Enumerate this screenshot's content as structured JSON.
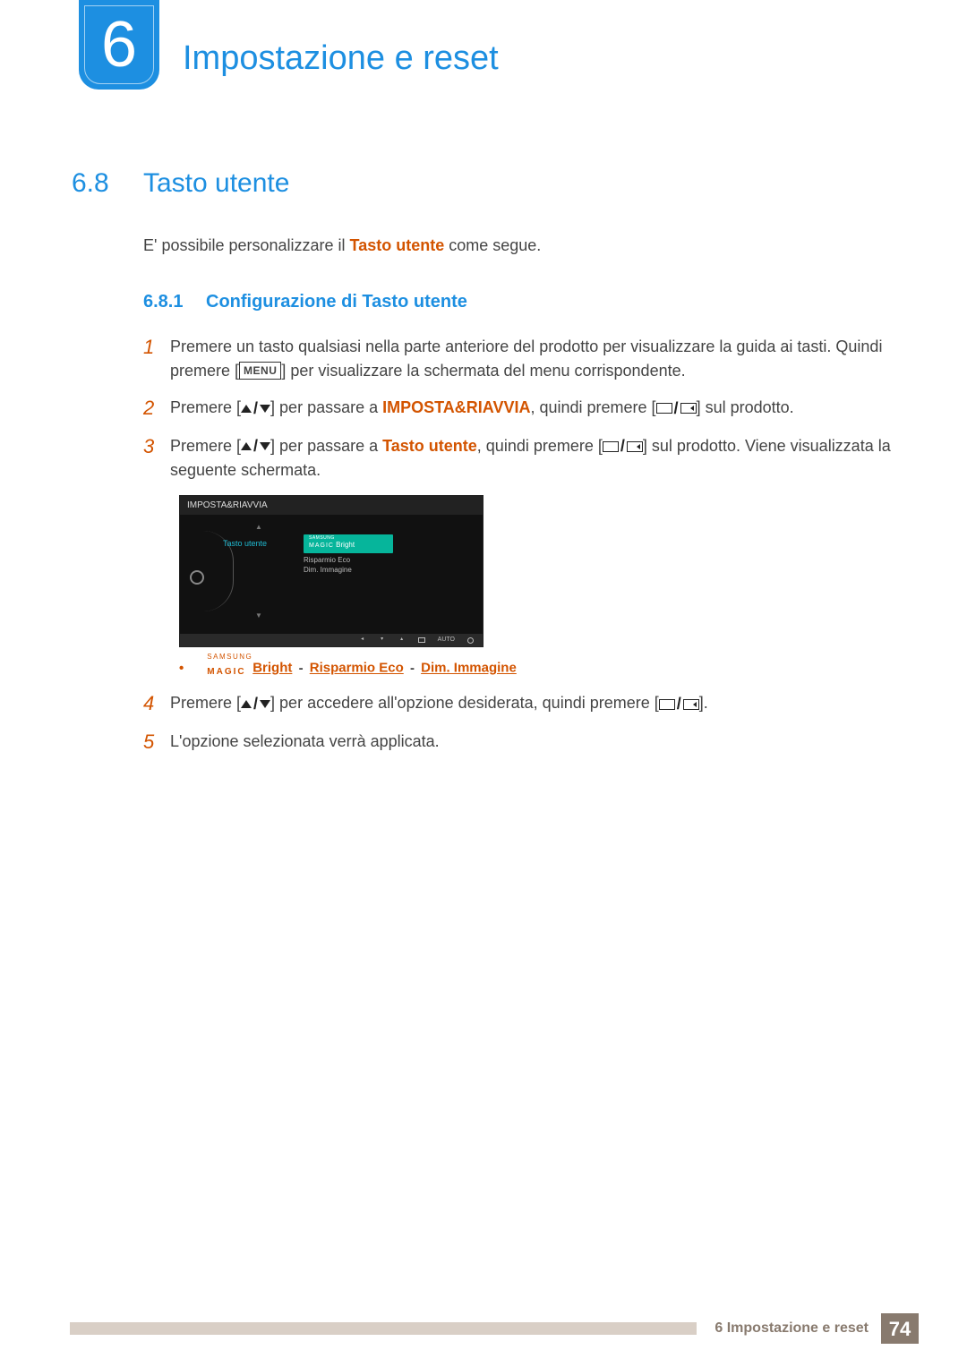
{
  "chapter": {
    "number": "6",
    "title": "Impostazione e reset"
  },
  "section": {
    "number": "6.8",
    "title": "Tasto utente"
  },
  "intro": {
    "prefix": "E' possibile personalizzare il ",
    "hl": "Tasto utente",
    "suffix": " come segue."
  },
  "subsection": {
    "number": "6.8.1",
    "title": "Configurazione di Tasto utente"
  },
  "steps": {
    "s1": {
      "num": "1",
      "t1": "Premere un tasto qualsiasi nella parte anteriore del prodotto per visualizzare la guida ai tasti. Quindi premere [",
      "menu": "MENU",
      "t2": "] per visualizzare la schermata del menu corrispondente."
    },
    "s2": {
      "num": "2",
      "t1": "Premere [",
      "t2": "] per passare a ",
      "hl": "IMPOSTA&RIAVVIA",
      "t3": ", quindi premere [",
      "t4": "] sul prodotto."
    },
    "s3": {
      "num": "3",
      "t1": "Premere [",
      "t2": "] per passare a ",
      "hl": "Tasto utente",
      "t3": ", quindi premere [",
      "t4": "] sul prodotto. Viene visualizzata la seguente schermata."
    },
    "s4": {
      "num": "4",
      "t1": "Premere [",
      "t2": "] per accedere all'opzione desiderata, quindi premere [",
      "t3": "]."
    },
    "s5": {
      "num": "5",
      "t1": "L'opzione selezionata verrà applicata."
    }
  },
  "osd": {
    "title": "IMPOSTA&RIAVVIA",
    "item": "Tasto utente",
    "sel_sup": "SAMSUNG",
    "sel_main": "MAGIC",
    "sel_suffix": " Bright",
    "opt2": "Risparmio Eco",
    "opt3": "Dim. Immagine",
    "auto": "AUTO"
  },
  "bullet": {
    "magic_sup": "SAMSUNG",
    "magic_main": "MAGIC",
    "o1": "Bright",
    "o2": "Risparmio Eco",
    "o3": "Dim. Immagine"
  },
  "footer": {
    "text": "6 Impostazione e reset",
    "page": "74"
  }
}
